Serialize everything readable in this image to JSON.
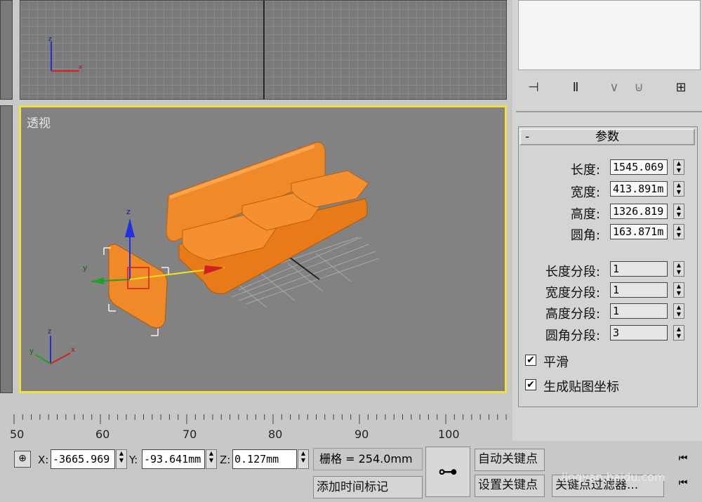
{
  "viewport": {
    "perspective_label": "透视"
  },
  "command_panel": {
    "rollout_title": "参数",
    "rollout_toggle": "-",
    "params": [
      {
        "label": "长度:",
        "value": "1545.069"
      },
      {
        "label": "宽度:",
        "value": "413.891m"
      },
      {
        "label": "高度:",
        "value": "1326.819"
      },
      {
        "label": "圆角:",
        "value": "163.871m"
      }
    ],
    "segments": [
      {
        "label": "长度分段:",
        "value": "1"
      },
      {
        "label": "宽度分段:",
        "value": "1"
      },
      {
        "label": "高度分段:",
        "value": "1"
      },
      {
        "label": "圆角分段:",
        "value": "3"
      }
    ],
    "checkboxes": [
      {
        "label": "平滑",
        "checked": true
      },
      {
        "label": "生成贴图坐标",
        "checked": true
      }
    ]
  },
  "timeline": {
    "ticks": [
      "50",
      "60",
      "70",
      "80",
      "90",
      "100"
    ]
  },
  "status_bar": {
    "x_label": "X:",
    "x_value": "-3665.969",
    "y_label": "Y:",
    "y_value": "-93.641mm",
    "z_label": "Z:",
    "z_value": "0.127mm",
    "grid": "栅格 = 254.0mm",
    "add_time_tag": "添加时间标记",
    "auto_key": "自动关键点",
    "set_key": "设置关键点",
    "key_filters": "关键点过滤器..."
  },
  "watermark": "jingyan.baidu.com"
}
